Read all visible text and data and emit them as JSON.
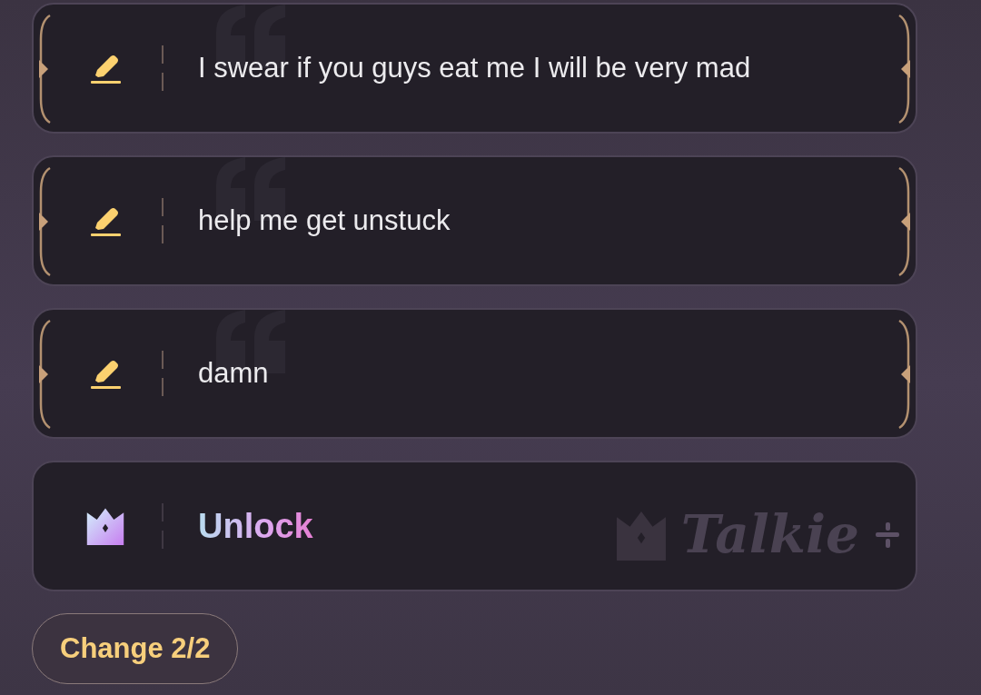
{
  "cards": [
    {
      "kind": "suggestion",
      "text": "I swear if you guys eat me I will be very mad"
    },
    {
      "kind": "suggestion",
      "text": "help me get unstuck"
    },
    {
      "kind": "suggestion",
      "text": "damn"
    },
    {
      "kind": "unlock",
      "text": "Unlock",
      "brand": "Talkie"
    }
  ],
  "change_button": {
    "label": "Change 2/2"
  }
}
